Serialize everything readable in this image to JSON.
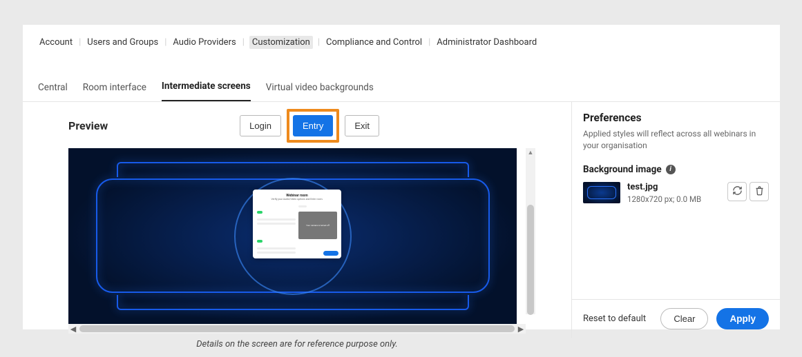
{
  "topnav": {
    "items": [
      {
        "label": "Account"
      },
      {
        "label": "Users and Groups"
      },
      {
        "label": "Audio Providers"
      },
      {
        "label": "Customization",
        "active": true
      },
      {
        "label": "Compliance and Control"
      },
      {
        "label": "Administrator Dashboard"
      }
    ]
  },
  "subtabs": {
    "items": [
      {
        "label": "Central"
      },
      {
        "label": "Room interface"
      },
      {
        "label": "Intermediate screens",
        "active": true
      },
      {
        "label": "Virtual video backgrounds"
      }
    ]
  },
  "preview": {
    "title": "Preview",
    "segments": {
      "login": "Login",
      "entry": "Entry",
      "exit": "Exit"
    },
    "dialog": {
      "title": "Webinar room",
      "subtitle": "Verify your Audio/Video options and Enter room.",
      "camera_off": "Your camera is turned off"
    },
    "note": "Details on the screen are for reference purpose only."
  },
  "preferences": {
    "title": "Preferences",
    "desc": "Applied styles will reflect across all webinars in your organisation",
    "bg_label": "Background image",
    "file": {
      "name": "test.jpg",
      "meta": "1280x720 px; 0.0 MB"
    },
    "footer": {
      "reset": "Reset to default",
      "clear": "Clear",
      "apply": "Apply"
    }
  }
}
